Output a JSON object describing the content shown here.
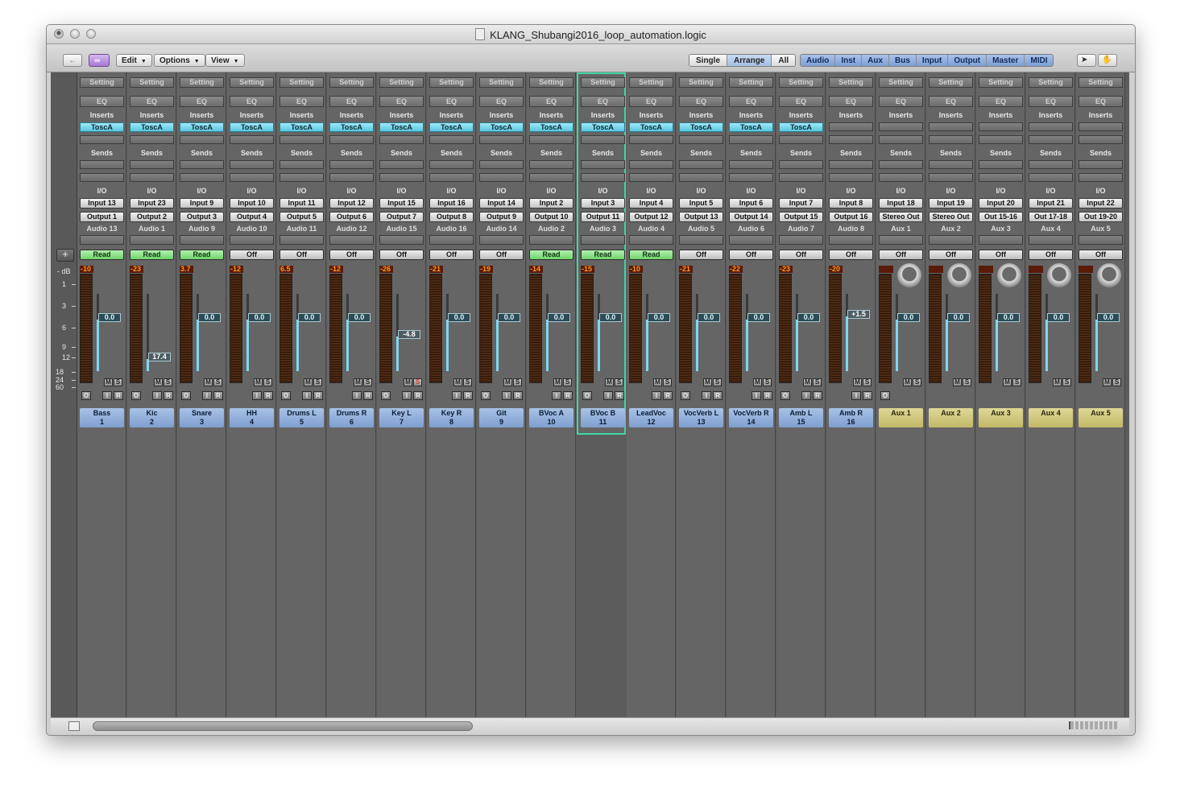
{
  "window": {
    "title": "KLANG_Shubangi2016_loop_automation.logic"
  },
  "toolbar": {
    "menus": [
      "Edit",
      "Options",
      "View"
    ],
    "view_modes": [
      "Single",
      "Arrange",
      "All"
    ],
    "view_mode_selected": "Arrange",
    "filters": [
      "Audio",
      "Inst",
      "Aux",
      "Bus",
      "Input",
      "Output",
      "Master",
      "MIDI"
    ]
  },
  "labels": {
    "setting": "Setting",
    "eq": "EQ",
    "inserts": "Inserts",
    "sends": "Sends",
    "io": "I/O",
    "mute": "M",
    "solo": "S",
    "rec": "R",
    "input_mon": "I",
    "group": "O",
    "db": "- dB"
  },
  "db_scale": [
    "1",
    "3",
    "6",
    "9",
    "12",
    "18",
    "24",
    "60"
  ],
  "colors": {
    "insert": "#58c6df",
    "read": "#6fd36a",
    "audio_name": "#7f9fcf",
    "aux_name": "#c2b867",
    "selection": "#3fd6a5",
    "fader_fill": "#7fd7ee"
  },
  "channels": [
    {
      "name": "Bass",
      "number": "1",
      "insert": "ToscA",
      "input": "Input 13",
      "output": "Output 1",
      "track": "Audio 13",
      "automation": "Read",
      "peak": "-10",
      "fader": "0.0",
      "level": 0.67,
      "type": "audio",
      "solo": false,
      "rec": true
    },
    {
      "name": "Kic",
      "number": "2",
      "insert": "ToscA",
      "input": "Input 23",
      "output": "Output 2",
      "track": "Audio 1",
      "automation": "Read",
      "peak": "-23",
      "fader": "17.4",
      "level": 0.16,
      "type": "audio",
      "solo": false,
      "rec": true
    },
    {
      "name": "Snare",
      "number": "3",
      "insert": "ToscA",
      "input": "Input 9",
      "output": "Output 3",
      "track": "Audio 9",
      "automation": "Read",
      "peak": "3.7",
      "fader": "0.0",
      "level": 0.67,
      "type": "audio",
      "solo": false,
      "rec": true
    },
    {
      "name": "HH",
      "number": "4",
      "insert": "ToscA",
      "input": "Input 10",
      "output": "Output 4",
      "track": "Audio 10",
      "automation": "Off",
      "peak": "-12",
      "fader": "0.0",
      "level": 0.67,
      "type": "audio",
      "solo": false,
      "rec": true
    },
    {
      "name": "Drums L",
      "number": "5",
      "insert": "ToscA",
      "input": "Input 11",
      "output": "Output 5",
      "track": "Audio 11",
      "automation": "Off",
      "peak": "6.5",
      "fader": "0.0",
      "level": 0.67,
      "type": "audio",
      "solo": false,
      "rec": true
    },
    {
      "name": "Drums R",
      "number": "6",
      "insert": "ToscA",
      "input": "Input 12",
      "output": "Output 6",
      "track": "Audio 12",
      "automation": "Off",
      "peak": "-12",
      "fader": "0.0",
      "level": 0.67,
      "type": "audio",
      "solo": false,
      "rec": true
    },
    {
      "name": "Key L",
      "number": "7",
      "insert": "ToscA",
      "input": "Input 15",
      "output": "Output 7",
      "track": "Audio 15",
      "automation": "Off",
      "peak": "-26",
      "fader": "-4.8",
      "level": 0.45,
      "type": "audio",
      "solo": true,
      "rec": true
    },
    {
      "name": "Key R",
      "number": "8",
      "insert": "ToscA",
      "input": "Input 16",
      "output": "Output 8",
      "track": "Audio 16",
      "automation": "Off",
      "peak": "-21",
      "fader": "0.0",
      "level": 0.67,
      "type": "audio",
      "solo": false,
      "rec": true
    },
    {
      "name": "Git",
      "number": "9",
      "insert": "ToscA",
      "input": "Input 14",
      "output": "Output 9",
      "track": "Audio 14",
      "automation": "Off",
      "peak": "-19",
      "fader": "0.0",
      "level": 0.67,
      "type": "audio",
      "solo": false,
      "rec": true
    },
    {
      "name": "BVoc A",
      "number": "10",
      "insert": "ToscA",
      "input": "Input 2",
      "output": "Output 10",
      "track": "Audio 2",
      "automation": "Read",
      "peak": "-14",
      "fader": "0.0",
      "level": 0.67,
      "type": "audio",
      "solo": false,
      "rec": true
    },
    {
      "name": "BVoc B",
      "number": "11",
      "insert": "ToscA",
      "input": "Input 3",
      "output": "Output 11",
      "track": "Audio 3",
      "automation": "Read",
      "peak": "-15",
      "fader": "0.0",
      "level": 0.67,
      "type": "audio",
      "solo": false,
      "rec": true,
      "selected": true
    },
    {
      "name": "LeadVoc",
      "number": "12",
      "insert": "ToscA",
      "input": "Input 4",
      "output": "Output 12",
      "track": "Audio 4",
      "automation": "Read",
      "peak": "-10",
      "fader": "0.0",
      "level": 0.67,
      "type": "audio",
      "solo": false,
      "rec": true
    },
    {
      "name": "VocVerb L",
      "number": "13",
      "insert": "ToscA",
      "input": "Input 5",
      "output": "Output 13",
      "track": "Audio 5",
      "automation": "Off",
      "peak": "-21",
      "fader": "0.0",
      "level": 0.67,
      "type": "audio",
      "solo": false,
      "rec": true
    },
    {
      "name": "VocVerb R",
      "number": "14",
      "insert": "ToscA",
      "input": "Input 6",
      "output": "Output 14",
      "track": "Audio 6",
      "automation": "Off",
      "peak": "-22",
      "fader": "0.0",
      "level": 0.67,
      "type": "audio",
      "solo": false,
      "rec": true
    },
    {
      "name": "Amb L",
      "number": "15",
      "insert": "ToscA",
      "input": "Input 7",
      "output": "Output 15",
      "track": "Audio 7",
      "automation": "Off",
      "peak": "-23",
      "fader": "0.0",
      "level": 0.67,
      "type": "audio",
      "solo": false,
      "rec": true
    },
    {
      "name": "Amb R",
      "number": "16",
      "insert": "",
      "input": "Input 8",
      "output": "Output 16",
      "track": "Audio 8",
      "automation": "Off",
      "peak": "-20",
      "fader": "+1.5",
      "level": 0.71,
      "type": "audio",
      "solo": false,
      "rec": true
    },
    {
      "name": "Aux 1",
      "number": "",
      "insert": "",
      "input": "Input 18",
      "output": "Stereo Out",
      "track": "Aux 1",
      "automation": "Off",
      "peak": "",
      "fader": "0.0",
      "level": 0.67,
      "type": "aux",
      "solo": false,
      "rec": false
    },
    {
      "name": "Aux 2",
      "number": "",
      "insert": "",
      "input": "Input 19",
      "output": "Stereo Out",
      "track": "Aux 2",
      "automation": "Off",
      "peak": "",
      "fader": "0.0",
      "level": 0.67,
      "type": "aux",
      "solo": false,
      "rec": false
    },
    {
      "name": "Aux 3",
      "number": "",
      "insert": "",
      "input": "Input 20",
      "output": "Out 15-16",
      "track": "Aux 3",
      "automation": "Off",
      "peak": "",
      "fader": "0.0",
      "level": 0.67,
      "type": "aux",
      "solo": false,
      "rec": false
    },
    {
      "name": "Aux 4",
      "number": "",
      "insert": "",
      "input": "Input 21",
      "output": "Out 17-18",
      "track": "Aux 4",
      "automation": "Off",
      "peak": "",
      "fader": "0.0",
      "level": 0.67,
      "type": "aux",
      "solo": false,
      "rec": false
    },
    {
      "name": "Aux 5",
      "number": "",
      "insert": "",
      "input": "Input 22",
      "output": "Out 19-20",
      "track": "Aux 5",
      "automation": "Off",
      "peak": "",
      "fader": "0.0",
      "level": 0.67,
      "type": "aux",
      "solo": false,
      "rec": false
    }
  ]
}
